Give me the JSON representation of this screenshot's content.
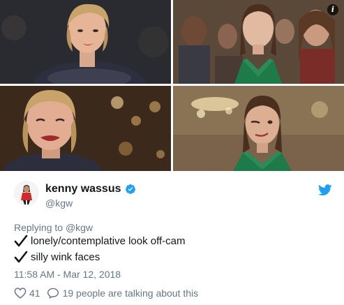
{
  "media": {
    "frames": [
      {
        "description_icon": "photo"
      },
      {
        "description_icon": "photo"
      },
      {
        "description_icon": "photo"
      },
      {
        "description_icon": "photo"
      }
    ],
    "info_icon": "info-icon",
    "info_glyph": "i"
  },
  "tweet": {
    "author_name": "kenny wassus",
    "author_handle": "@kgw",
    "verified_icon": "verified-badge-icon",
    "platform_icon": "twitter-bird-icon",
    "replying_to_label": "Replying to",
    "replying_to_handle": "@kgw",
    "lines": [
      "lonely/contemplative look off-cam",
      "silly wink faces"
    ],
    "timestamp": "11:58 AM - Mar 12, 2018",
    "like_count": "41",
    "talking_text": "19 people are talking about this"
  },
  "colors": {
    "accent": "#1da1f2",
    "like": "#657786",
    "text": "#14171a",
    "muted": "#657786"
  }
}
